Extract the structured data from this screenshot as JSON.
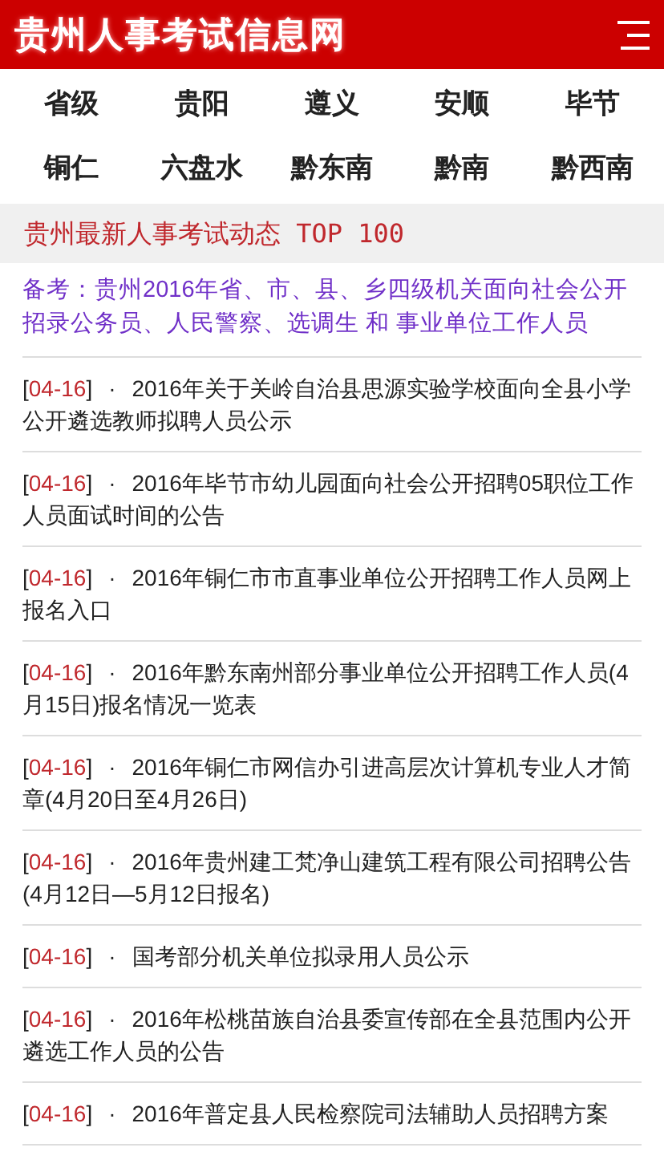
{
  "header": {
    "title": "贵州人事考试信息网"
  },
  "nav": [
    "省级",
    "贵阳",
    "遵义",
    "安顺",
    "毕节",
    "铜仁",
    "六盘水",
    "黔东南",
    "黔南",
    "黔西南"
  ],
  "section": {
    "title": "贵州最新人事考试动态 TOP 100"
  },
  "note": "备考：贵州2016年省、市、县、乡四级机关面向社会公开招录公务员、人民警察、选调生 和 事业单位工作人员",
  "news": [
    {
      "open": "[",
      "date": "04-16",
      "close": "]",
      "bullet": "·",
      "title": "2016年关于关岭自治县思源实验学校面向全县小学公开遴选教师拟聘人员公示"
    },
    {
      "open": "[",
      "date": "04-16",
      "close": "]",
      "bullet": "·",
      "title": "2016年毕节市幼儿园面向社会公开招聘05职位工作人员面试时间的公告"
    },
    {
      "open": "[",
      "date": "04-16",
      "close": "]",
      "bullet": "·",
      "title": "2016年铜仁市市直事业单位公开招聘工作人员网上报名入口"
    },
    {
      "open": "[",
      "date": "04-16",
      "close": "]",
      "bullet": "·",
      "title": "2016年黔东南州部分事业单位公开招聘工作人员(4月15日)报名情况一览表"
    },
    {
      "open": "[",
      "date": "04-16",
      "close": "]",
      "bullet": "·",
      "title": "2016年铜仁市网信办引进高层次计算机专业人才简章(4月20日至4月26日)"
    },
    {
      "open": "[",
      "date": "04-16",
      "close": "]",
      "bullet": "·",
      "title": "2016年贵州建工梵净山建筑工程有限公司招聘公告(4月12日—5月12日报名)"
    },
    {
      "open": "[",
      "date": "04-16",
      "close": "]",
      "bullet": "·",
      "title": "国考部分机关单位拟录用人员公示"
    },
    {
      "open": "[",
      "date": "04-16",
      "close": "]",
      "bullet": "·",
      "title": "2016年松桃苗族自治县委宣传部在全县范围内公开遴选工作人员的公告"
    },
    {
      "open": "[",
      "date": "04-16",
      "close": "]",
      "bullet": "·",
      "title": "2016年普定县人民检察院司法辅助人员招聘方案"
    }
  ]
}
